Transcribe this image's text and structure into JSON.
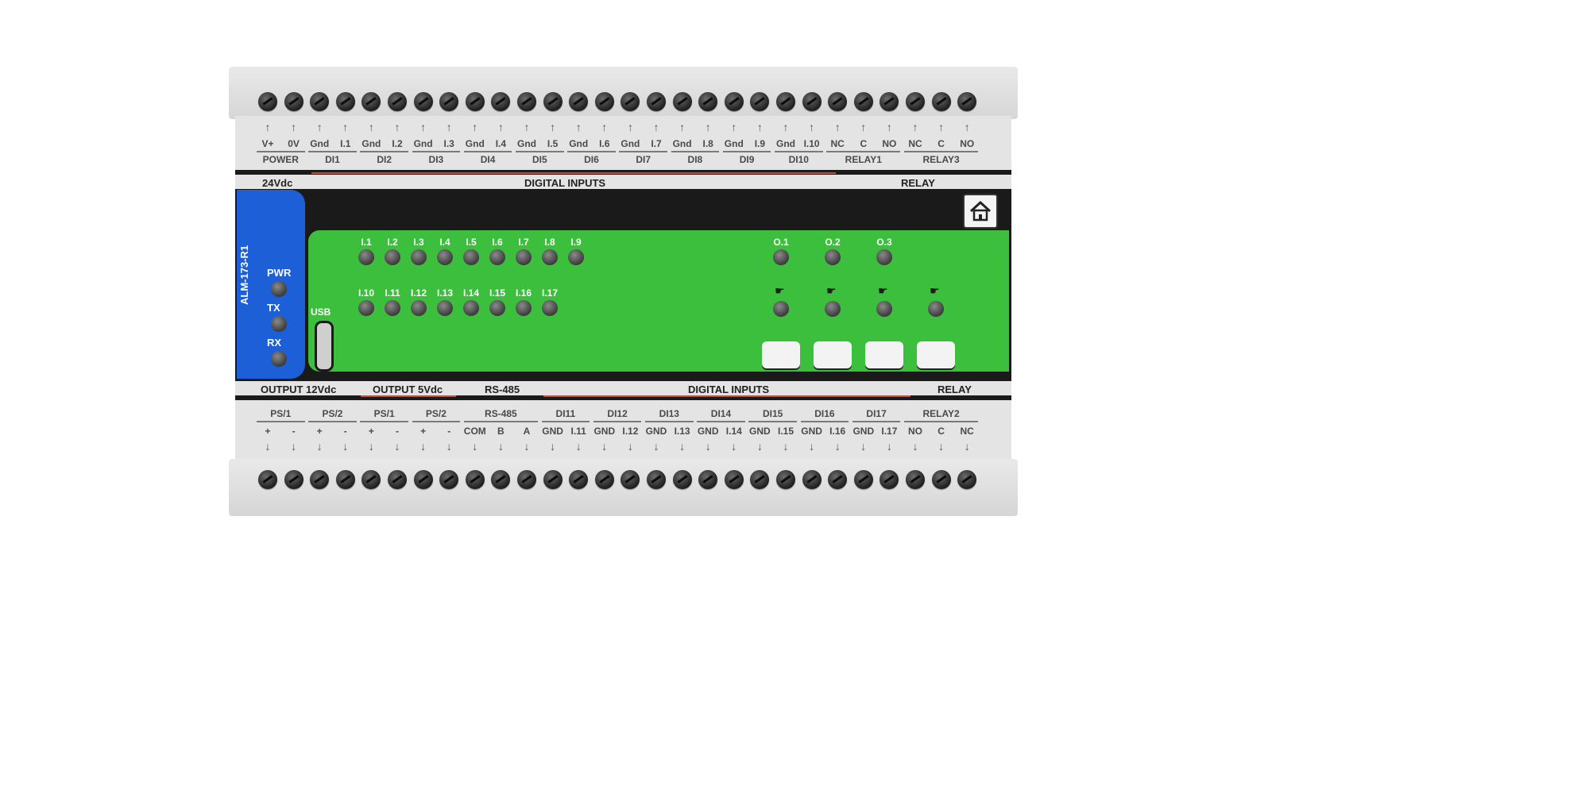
{
  "model": "ALM-173-R1",
  "status_leds": [
    "PWR",
    "TX",
    "RX"
  ],
  "usb_label": "USB",
  "top_pins": [
    "V+",
    "0V",
    "Gnd",
    "I.1",
    "Gnd",
    "I.2",
    "Gnd",
    "I.3",
    "Gnd",
    "I.4",
    "Gnd",
    "I.5",
    "Gnd",
    "I.6",
    "Gnd",
    "I.7",
    "Gnd",
    "I.8",
    "Gnd",
    "I.9",
    "Gnd",
    "I.10",
    "NC",
    "C",
    "NO",
    "NC",
    "C",
    "NO"
  ],
  "top_groups": [
    "POWER",
    "DI1",
    "DI2",
    "DI3",
    "DI4",
    "DI5",
    "DI6",
    "DI7",
    "DI8",
    "DI9",
    "DI10",
    "RELAY1",
    "RELAY3"
  ],
  "top_headers": {
    "power": "24Vdc",
    "inputs": "DIGITAL INPUTS",
    "relay": "RELAY"
  },
  "input_leds_row1": [
    "I.1",
    "I.2",
    "I.3",
    "I.4",
    "I.5",
    "I.6",
    "I.7",
    "I.8",
    "I.9"
  ],
  "input_leds_row2": [
    "I.10",
    "I.11",
    "I.12",
    "I.13",
    "I.14",
    "I.15",
    "I.16",
    "I.17"
  ],
  "output_leds": [
    "O.1",
    "O.2",
    "O.3"
  ],
  "bottom_headers": {
    "out12": "OUTPUT 12Vdc",
    "out5": "OUTPUT 5Vdc",
    "rs485": "RS-485",
    "inputs": "DIGITAL INPUTS",
    "relay": "RELAY"
  },
  "bottom_groups": [
    "PS/1",
    "PS/2",
    "PS/1",
    "PS/2",
    "RS-485",
    "DI11",
    "DI12",
    "DI13",
    "DI14",
    "DI15",
    "DI16",
    "DI17",
    "RELAY2"
  ],
  "bottom_pins": [
    "+",
    "-",
    "+",
    "-",
    "+",
    "-",
    "+",
    "-",
    "COM",
    "B",
    "A",
    "GND",
    "I.11",
    "GND",
    "I.12",
    "GND",
    "I.13",
    "GND",
    "I.14",
    "GND",
    "I.15",
    "GND",
    "I.16",
    "GND",
    "I.17",
    "NO",
    "C",
    "NC"
  ],
  "colors": {
    "panel_green": "#3cbf3c",
    "panel_blue": "#1d5fd6",
    "housing": "#dcdcdc",
    "accent_red": "#c0503a"
  }
}
